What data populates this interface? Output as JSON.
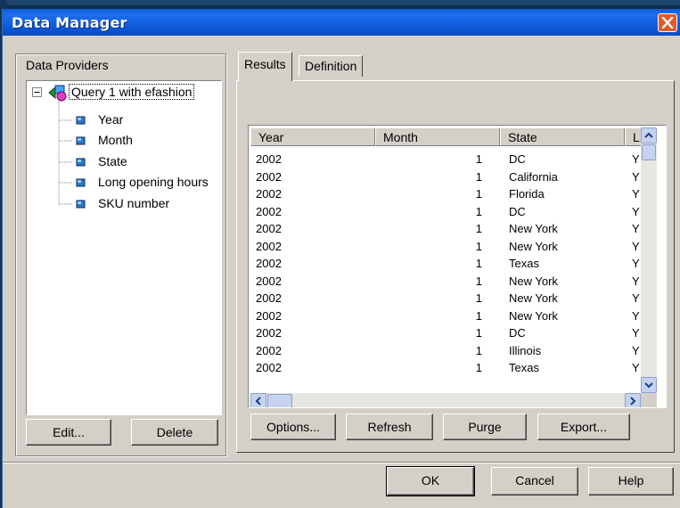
{
  "window": {
    "title": "Data Manager"
  },
  "providers": {
    "label": "Data Providers",
    "root": "Query 1 with efashion",
    "objects": [
      "Year",
      "Month",
      "State",
      "Long opening hours",
      "SKU number"
    ]
  },
  "left_buttons": {
    "edit": "Edit...",
    "delete": "Delete"
  },
  "tabs": [
    "Results",
    "Definition"
  ],
  "grid": {
    "columns": [
      "Year",
      "Month",
      "State",
      "L"
    ],
    "rows": [
      [
        "2002",
        "1",
        "DC",
        "Y"
      ],
      [
        "2002",
        "1",
        "California",
        "Y"
      ],
      [
        "2002",
        "1",
        "Florida",
        "Y"
      ],
      [
        "2002",
        "1",
        "DC",
        "Y"
      ],
      [
        "2002",
        "1",
        "New York",
        "Y"
      ],
      [
        "2002",
        "1",
        "New York",
        "Y"
      ],
      [
        "2002",
        "1",
        "Texas",
        "Y"
      ],
      [
        "2002",
        "1",
        "New York",
        "Y"
      ],
      [
        "2002",
        "1",
        "New York",
        "Y"
      ],
      [
        "2002",
        "1",
        "New York",
        "Y"
      ],
      [
        "2002",
        "1",
        "DC",
        "Y"
      ],
      [
        "2002",
        "1",
        "Illinois",
        "Y"
      ],
      [
        "2002",
        "1",
        "Texas",
        "Y"
      ]
    ]
  },
  "result_buttons": {
    "options": "Options...",
    "refresh": "Refresh",
    "purge": "Purge",
    "export": "Export..."
  },
  "dialog_buttons": {
    "ok": "OK",
    "cancel": "Cancel",
    "help": "Help"
  }
}
